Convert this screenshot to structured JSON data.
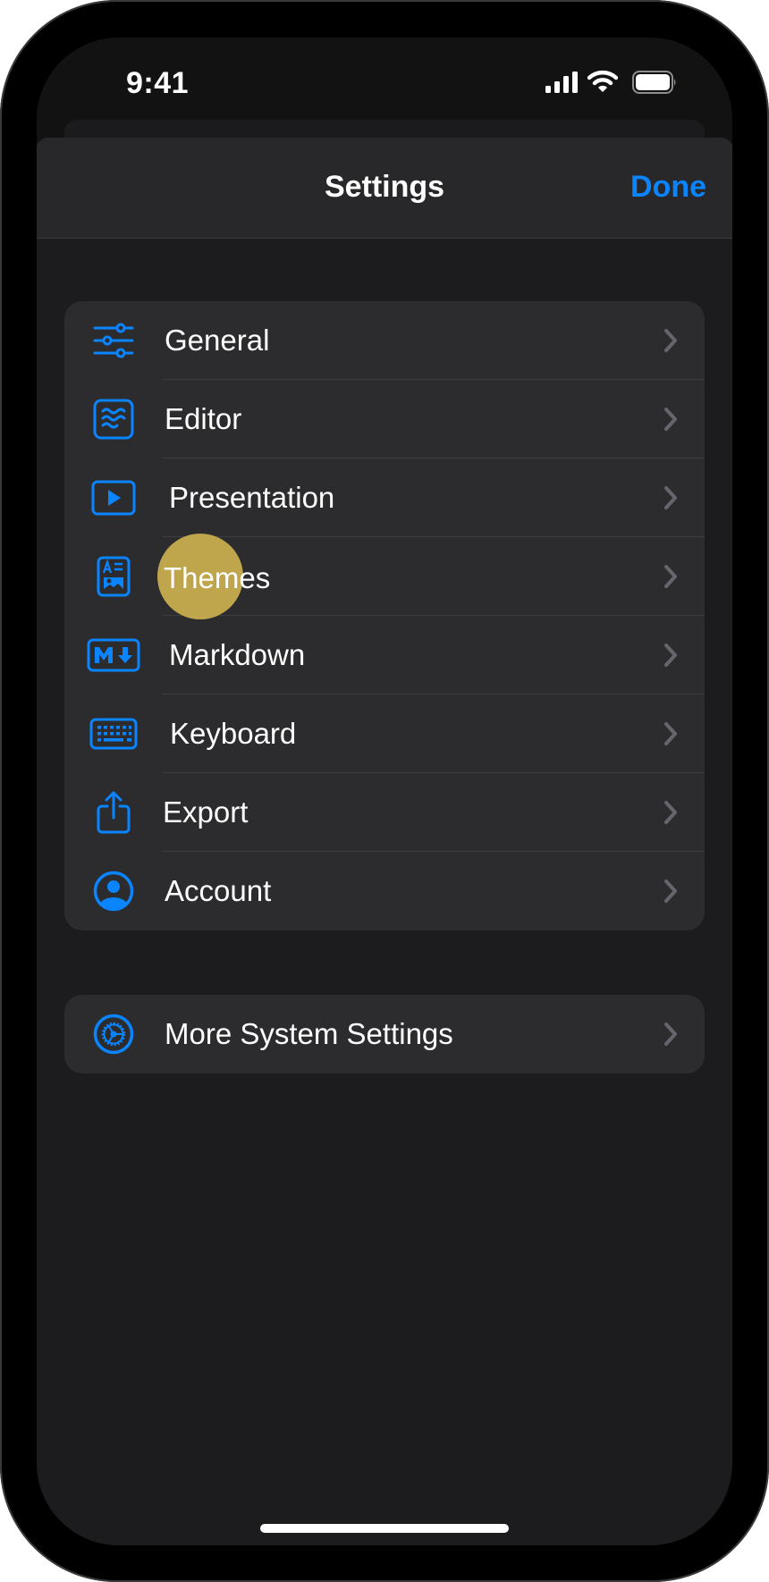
{
  "status_bar": {
    "time": "9:41",
    "icons": [
      "cellular-signal-icon",
      "wifi-icon",
      "battery-icon"
    ]
  },
  "nav": {
    "title": "Settings",
    "done_label": "Done"
  },
  "colors": {
    "accent": "#0A84FF",
    "tap_indicator": "#BFA64C",
    "background": "#1C1C1E",
    "cell": "#2C2C2E"
  },
  "groups": [
    {
      "items": [
        {
          "label": "General",
          "icon": "sliders-icon"
        },
        {
          "label": "Editor",
          "icon": "text-wave-icon"
        },
        {
          "label": "Presentation",
          "icon": "play-rectangle-icon"
        },
        {
          "label": "Themes",
          "icon": "doc-image-icon"
        },
        {
          "label": "Markdown",
          "icon": "markdown-icon"
        },
        {
          "label": "Keyboard",
          "icon": "keyboard-icon"
        },
        {
          "label": "Export",
          "icon": "share-icon"
        },
        {
          "label": "Account",
          "icon": "person-circle-icon"
        }
      ]
    },
    {
      "items": [
        {
          "label": "More System Settings",
          "icon": "gear-circle-icon"
        }
      ]
    }
  ],
  "tap_indicator": {
    "target": "Themes"
  }
}
